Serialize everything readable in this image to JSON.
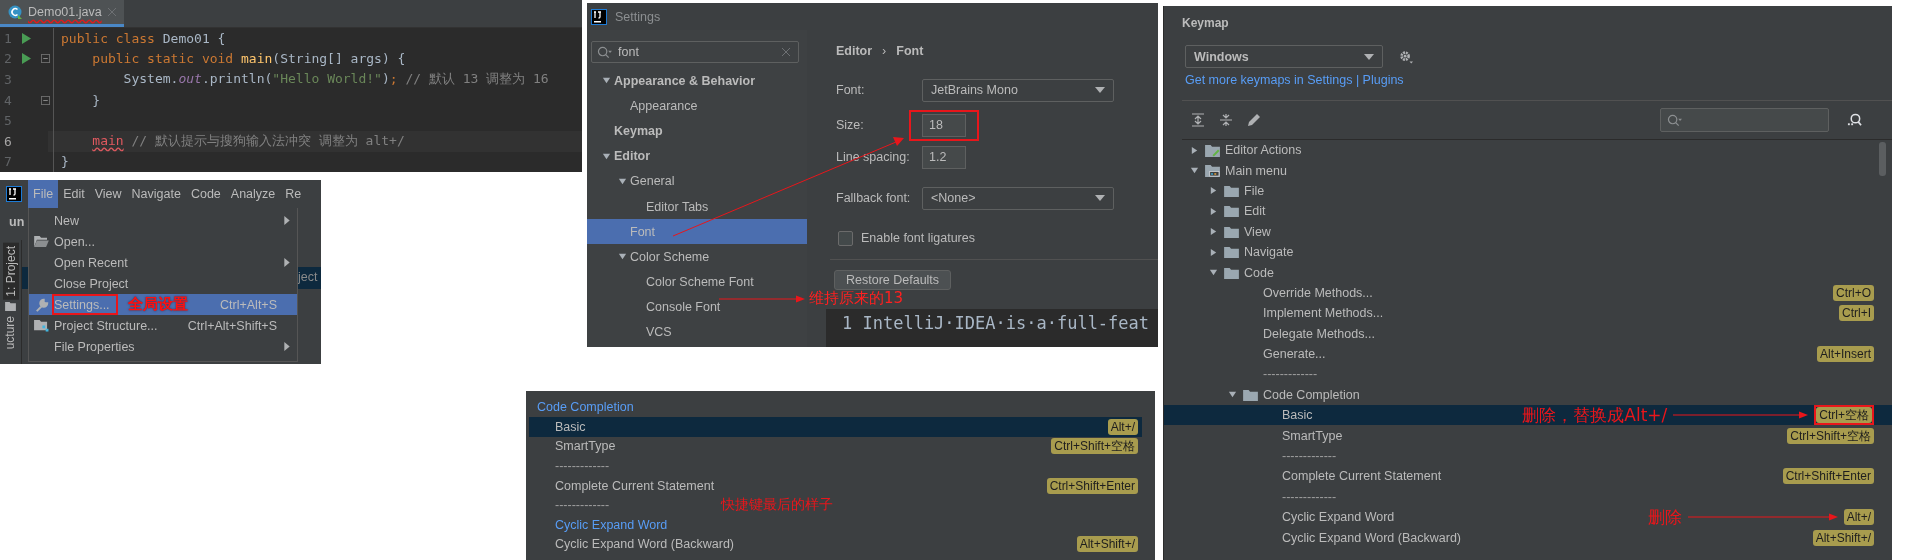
{
  "editor": {
    "tab": {
      "title": "Demo01.java",
      "has_error": true
    },
    "lines": [
      {
        "number": "1",
        "run": true,
        "fold": false,
        "current": false,
        "tokens": [
          {
            "kind": "keyword",
            "text": "public class "
          },
          {
            "kind": "plain",
            "text": "Demo01 {"
          }
        ]
      },
      {
        "number": "2",
        "run": true,
        "fold": true,
        "current": false,
        "tokens": [
          {
            "kind": "keyword",
            "text": "    public static void "
          },
          {
            "kind": "method",
            "text": "main"
          },
          {
            "kind": "plain",
            "text": "(String[] args) {"
          }
        ]
      },
      {
        "number": "3",
        "run": false,
        "fold": false,
        "current": false,
        "tokens": [
          {
            "kind": "plain",
            "text": "        System."
          },
          {
            "kind": "field",
            "text": "out"
          },
          {
            "kind": "plain",
            "text": ".println("
          },
          {
            "kind": "string",
            "text": "\"Hello World!\""
          },
          {
            "kind": "plain",
            "text": ")"
          },
          {
            "kind": "keyword",
            "text": ";"
          },
          {
            "kind": "comment",
            "text": " // 默认 13 调整为 16"
          }
        ]
      },
      {
        "number": "4",
        "run": false,
        "fold": true,
        "current": false,
        "tokens": [
          {
            "kind": "plain",
            "text": "    }"
          }
        ]
      },
      {
        "number": "5",
        "run": false,
        "fold": false,
        "current": false
      },
      {
        "number": "6",
        "run": false,
        "fold": false,
        "current": true,
        "tokens": [
          {
            "kind": "error",
            "text": "    main"
          },
          {
            "kind": "comment",
            "text": " // 默认提示与搜狗输入法冲突 调整为 alt+/"
          }
        ]
      },
      {
        "number": "7",
        "run": false,
        "fold": false,
        "current": false,
        "tokens": [
          {
            "kind": "plain",
            "text": "}"
          }
        ]
      }
    ]
  },
  "file_menu": {
    "menubar": [
      {
        "label": "File",
        "selected": true
      },
      {
        "label": "Edit",
        "selected": false
      },
      {
        "label": "View",
        "selected": false
      },
      {
        "label": "Navigate",
        "selected": false
      },
      {
        "label": "Code",
        "selected": false
      },
      {
        "label": "Analyze",
        "selected": false
      },
      {
        "label": "Re",
        "selected": false
      }
    ],
    "project_name": "un",
    "tree_fragment": "ject",
    "side_tabs": [
      "1: Project",
      "ucture"
    ],
    "items": [
      {
        "kind": "item",
        "label": "New",
        "submenu": true,
        "selected": false
      },
      {
        "kind": "folder-item",
        "label": "Open...",
        "submenu": false,
        "selected": false
      },
      {
        "kind": "item",
        "label": "Open Recent",
        "submenu": true,
        "selected": false
      },
      {
        "kind": "item",
        "label": "Close Project",
        "submenu": false,
        "selected": false
      },
      {
        "kind": "settings-item",
        "label": "Settings...",
        "shortcut": "Ctrl+Alt+S",
        "submenu": false,
        "selected": true,
        "annotated": true,
        "note": "全局设置"
      },
      {
        "kind": "structure-item",
        "label": "Project Structure...",
        "shortcut": "Ctrl+Alt+Shift+S",
        "submenu": false,
        "selected": false
      },
      {
        "kind": "item",
        "label": "File Properties",
        "submenu": true,
        "selected": false
      }
    ]
  },
  "settings": {
    "title": "Settings",
    "search": {
      "value": "font"
    },
    "tree": [
      {
        "label": "Appearance & Behavior",
        "expanded": true,
        "selected": false,
        "children": [
          {
            "label": "Appearance",
            "selected": false
          }
        ]
      },
      {
        "label": "Keymap",
        "selected": false
      },
      {
        "label": "Editor",
        "expanded": true,
        "selected": false,
        "children": [
          {
            "label": "General",
            "expanded": true,
            "selected": false,
            "children": [
              {
                "label": "Editor Tabs",
                "selected": false
              }
            ]
          },
          {
            "label": "Font",
            "selected": true
          },
          {
            "label": "Color Scheme",
            "expanded": true,
            "selected": false,
            "children": [
              {
                "label": "Color Scheme Font",
                "selected": false
              },
              {
                "label": "Console Font",
                "selected": false,
                "note": "维持原来的13"
              },
              {
                "label": "VCS",
                "selected": false
              }
            ]
          }
        ]
      }
    ],
    "breadcrumb": {
      "parent": "Editor",
      "separator": "›",
      "current": "Font"
    },
    "font": {
      "label": "Font:",
      "value": "JetBrains Mono"
    },
    "size": {
      "label": "Size:",
      "value": "18",
      "annotated": true
    },
    "line_spacing": {
      "label": "Line spacing:",
      "value": "1.2"
    },
    "fallback_font": {
      "label": "Fallback font:",
      "value": "<None>"
    },
    "ligatures": {
      "label": "Enable font ligatures",
      "checked": false
    },
    "restore_button": "Restore Defaults",
    "preview": "1 IntelliJ·IDEA·is·a·full-feat"
  },
  "completion_preview": {
    "header": "Code Completion",
    "rows": [
      {
        "kind": "action",
        "label": "Basic",
        "shortcut": "Alt+/",
        "selected": true,
        "modified": false
      },
      {
        "kind": "action",
        "label": "SmartType",
        "shortcut": "Ctrl+Shift+空格",
        "selected": false,
        "modified": false
      },
      {
        "kind": "separator",
        "label": "-------------",
        "selected": false
      },
      {
        "kind": "action",
        "label": "Complete Current Statement",
        "shortcut": "Ctrl+Shift+Enter",
        "selected": false,
        "modified": false
      },
      {
        "kind": "separator",
        "label": "-------------",
        "selected": false,
        "note": "快捷键最后的样子"
      },
      {
        "kind": "action",
        "label": "Cyclic Expand Word",
        "selected": false,
        "modified": true
      },
      {
        "kind": "action",
        "label": "Cyclic Expand Word (Backward)",
        "shortcut": "Alt+Shift+/",
        "selected": false,
        "modified": false
      }
    ]
  },
  "keymap": {
    "title": "Keymap",
    "scheme": {
      "value": "Windows"
    },
    "link": "Get more keymaps in Settings | Plugins",
    "tree": [
      {
        "kind": "editor-actions",
        "label": "Editor Actions",
        "expanded": false,
        "selected": false
      },
      {
        "kind": "main-menu",
        "label": "Main menu",
        "expanded": true,
        "selected": false,
        "children": [
          {
            "kind": "folder",
            "label": "File",
            "expanded": false,
            "selected": false
          },
          {
            "kind": "folder",
            "label": "Edit",
            "expanded": false,
            "selected": false
          },
          {
            "kind": "folder",
            "label": "View",
            "expanded": false,
            "selected": false
          },
          {
            "kind": "folder",
            "label": "Navigate",
            "expanded": false,
            "selected": false
          },
          {
            "kind": "folder",
            "label": "Code",
            "expanded": true,
            "selected": false,
            "children": [
              {
                "kind": "action",
                "label": "Override Methods...",
                "shortcut": "Ctrl+O",
                "selected": false
              },
              {
                "kind": "action",
                "label": "Implement Methods...",
                "shortcut": "Ctrl+I",
                "selected": false
              },
              {
                "kind": "action",
                "label": "Delegate Methods...",
                "selected": false
              },
              {
                "kind": "action",
                "label": "Generate...",
                "shortcut": "Alt+Insert",
                "selected": false
              },
              {
                "kind": "separator",
                "label": "-------------",
                "selected": false
              },
              {
                "kind": "folder",
                "label": "Code Completion",
                "expanded": true,
                "selected": false,
                "children": [
                  {
                    "kind": "action",
                    "label": "Basic",
                    "shortcut": "Ctrl+空格",
                    "selected": true,
                    "annotated": true,
                    "note": "删除，替换成Alt+/"
                  },
                  {
                    "kind": "action",
                    "label": "SmartType",
                    "shortcut": "Ctrl+Shift+空格",
                    "selected": false
                  },
                  {
                    "kind": "separator",
                    "label": "-------------",
                    "selected": false
                  },
                  {
                    "kind": "action",
                    "label": "Complete Current Statement",
                    "shortcut": "Ctrl+Shift+Enter",
                    "selected": false
                  },
                  {
                    "kind": "separator",
                    "label": "-------------",
                    "selected": false
                  },
                  {
                    "kind": "action",
                    "label": "Cyclic Expand Word",
                    "shortcut": "Alt+/",
                    "selected": false,
                    "note": "删除"
                  },
                  {
                    "kind": "action",
                    "label": "Cyclic Expand Word (Backward)",
                    "shortcut": "Alt+Shift+/",
                    "selected": false
                  }
                ]
              }
            ]
          }
        ]
      }
    ]
  }
}
